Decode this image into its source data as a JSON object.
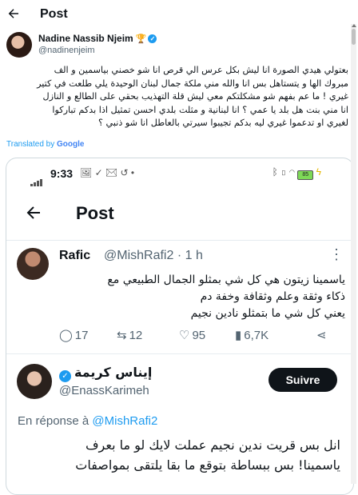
{
  "header": {
    "title": "Post"
  },
  "author": {
    "name": "Nadine Nassib Njeim",
    "badge": "🏆",
    "handle": "@nadinenjeim"
  },
  "tweet": {
    "lines": [
      "بعتولي هيدي الصورة انا ليش بكل عرس الي قرص انا شو خصني بياسمين و الف",
      "مبروك الها و يتستاهل بس انا والله مني ملكة جمال لبنان الوحيدة يلي طلعت في كتير",
      "غيري ! ما عم بفهم شو مشكلتكم معي ليش قلة التهذيب بحقي على الطالع و النازل",
      "انا مني بنت هل بلد يا عمي ؟ انا لبنانية و مثلت بلدي احسن تمثيل اذا بدكم تباركوا",
      "لغيري او تدعموا غيري ليه بدكم تجيبوا سيرتي بالعاطل انا شو ذنبي ؟"
    ],
    "translated_prefix": "Translated by ",
    "translated_brand": "Google"
  },
  "screenshot": {
    "status": {
      "time": "9:33",
      "battery": "85"
    },
    "post_title": "Post",
    "reply": {
      "name": "Rafic",
      "meta": "@MishRafi2 · 1 h",
      "lines": [
        "ياسمينا زيتون هي كل شي بمثلو الجمال الطبيعي مع",
        "ذكاء وثقة وعلم وثقافة وخفة دم",
        "يعني كل شي ما بتمثلو  نادين نجيم"
      ],
      "actions": {
        "replies": "17",
        "reposts": "12",
        "likes": "95",
        "views": "6,7K"
      }
    },
    "quoted": {
      "name": "إيناس كريمة",
      "handle": "@EnassKarimeh",
      "follow_label": "Suivre",
      "reply_prefix": "En réponse à ",
      "reply_handle": "@MishRafi2",
      "lines": [
        "انل بس قريت ندين نجيم عملت لايك لو ما بعرف",
        "ياسمينا! بس ببساطة بتوقع ما بقا يلتقى بمواصفات"
      ]
    }
  },
  "colors": {
    "accent": "#1d9bf0",
    "text": "#0f1419",
    "muted": "#536471"
  }
}
